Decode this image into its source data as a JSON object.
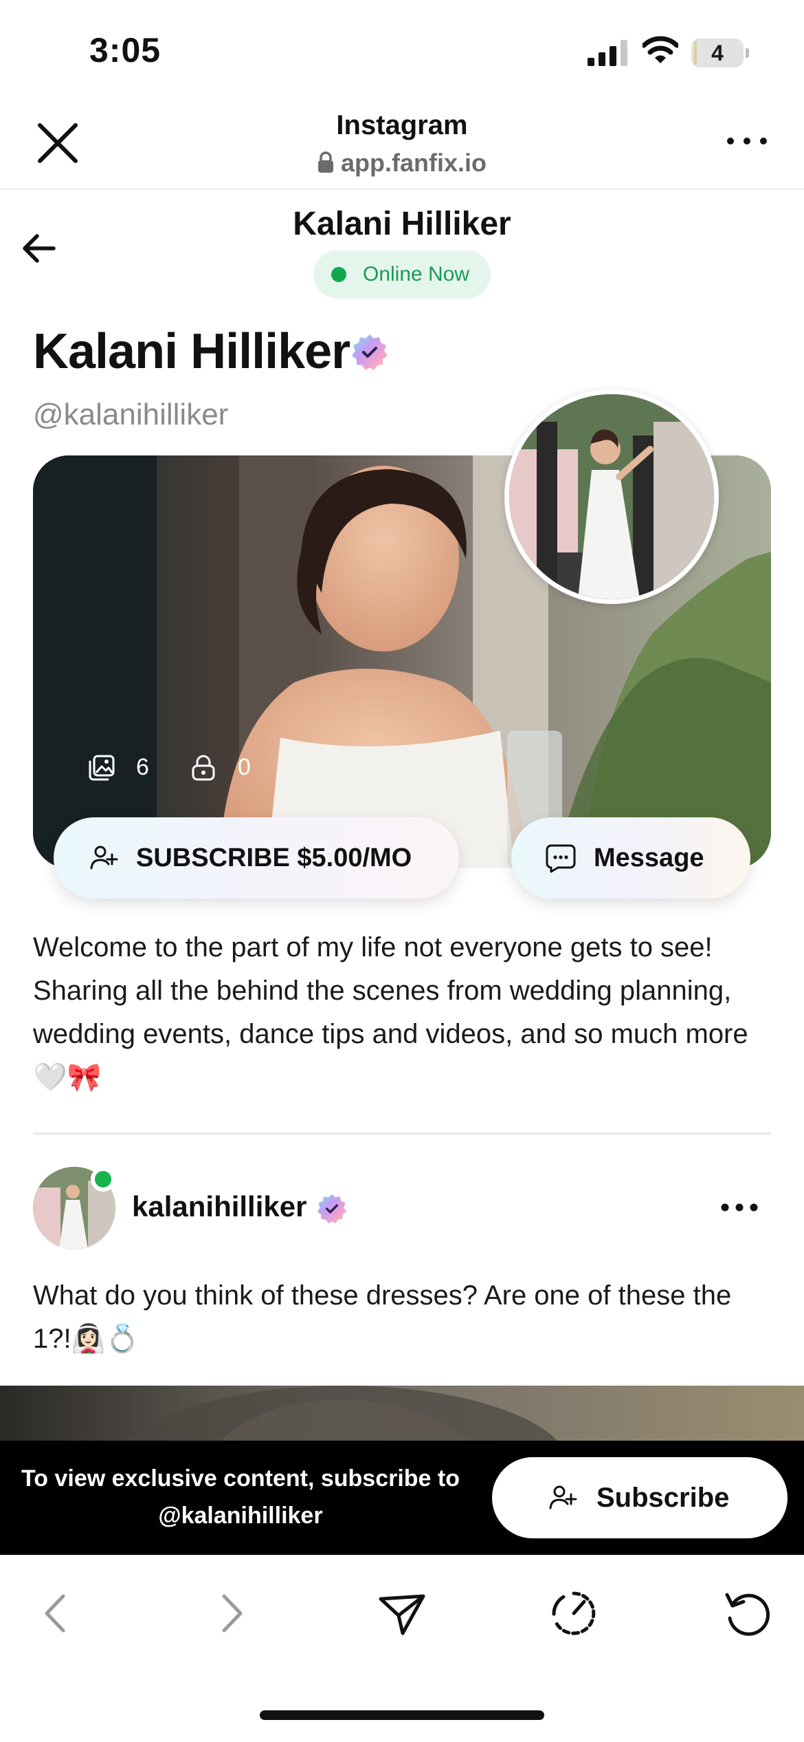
{
  "status_bar": {
    "time": "3:05",
    "battery_level": "4",
    "battery_fraction": 0.04
  },
  "browser": {
    "app_name": "Instagram",
    "url": "app.fanfix.io",
    "close_icon": "close-icon",
    "more_icon": "more-horizontal-icon"
  },
  "page_header": {
    "title": "Kalani Hilliker",
    "online_status": "Online Now",
    "online_color": "#0fa84c"
  },
  "profile": {
    "name": "Kalani Hilliker",
    "handle": "@kalanihilliker",
    "media_count": "6",
    "locked_count": "0",
    "subscribe_label": "SUBSCRIBE $5.00/MO",
    "message_label": "Message",
    "bio": "Welcome to the part of my life not everyone gets to see! Sharing all the behind the scenes from wedding planning, wedding events, dance tips and videos, and so much more🤍🎀"
  },
  "post": {
    "username": "kalanihilliker",
    "text": "What do you think of these dresses? Are one of these the 1?!👰🏻‍♀️💍"
  },
  "subscribe_banner": {
    "text": "To view exclusive content, subscribe to @kalanihilliker",
    "button_label": "Subscribe"
  },
  "toolbar": {
    "items": [
      "back-icon",
      "forward-icon",
      "share-icon",
      "speed-icon",
      "reload-icon"
    ]
  },
  "colors": {
    "accent_green": "#0fa84c",
    "banner_bg": "#000000",
    "verified_gradient": [
      "#7ee0f5",
      "#c49cf2",
      "#f7a4c8",
      "#ffd59a"
    ]
  }
}
